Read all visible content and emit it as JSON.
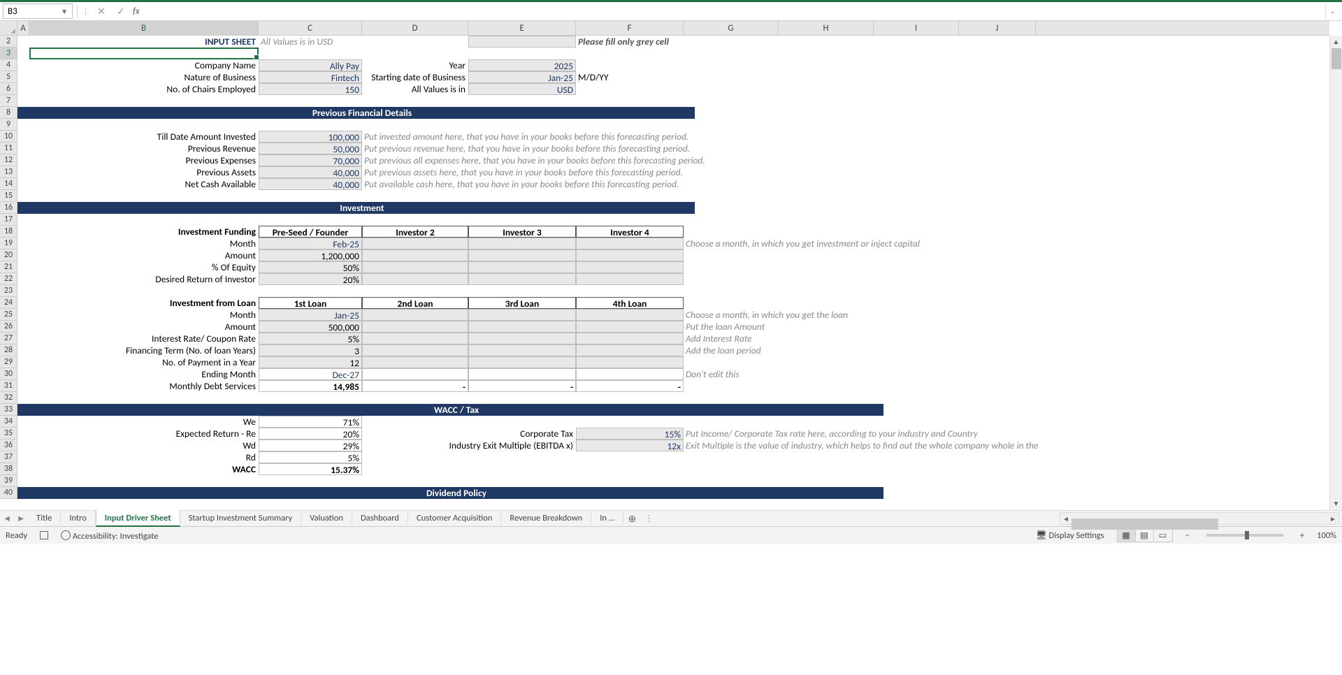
{
  "nameBox": "B3",
  "formula": "",
  "columns": [
    "A",
    "B",
    "C",
    "D",
    "E",
    "F",
    "G",
    "H",
    "I",
    "J"
  ],
  "rows": [
    "2",
    "3",
    "4",
    "5",
    "6",
    "7",
    "8",
    "9",
    "10",
    "11",
    "12",
    "13",
    "14",
    "15",
    "16",
    "17",
    "18",
    "19",
    "20",
    "21",
    "22",
    "23",
    "24",
    "25",
    "26",
    "27",
    "28",
    "29",
    "30",
    "31",
    "32",
    "33",
    "34",
    "35",
    "36",
    "37",
    "38",
    "39",
    "40"
  ],
  "top": {
    "inputSheet": "INPUT SHEET",
    "allValuesUsd": "All Values is in USD",
    "fillGreyCell": "Please fill only grey cell"
  },
  "company": {
    "labels": {
      "name": "Company Name",
      "nature": "Nature of Business",
      "chairs": "No. of Chairs Employed"
    },
    "values": {
      "name": "Ally Pay",
      "nature": "Fintech",
      "chairs": "150"
    },
    "yearLabel": "Year",
    "yearVal": "2025",
    "startDateLabel": "Starting date of Business",
    "startDateVal": "Jan-25",
    "mdy": "M/D/YY",
    "allValsInLabel": "All Values is in",
    "allValsInVal": "USD"
  },
  "sections": {
    "prevFin": "Previous Financial Details",
    "investment": "Investment",
    "wacc": "WACC / Tax",
    "dividend": "Dividend Policy"
  },
  "prevFin": {
    "rows": [
      {
        "label": "Till Date Amount Invested",
        "val": "100,000",
        "note": "Put invested amount here, that you have in your books before this forecasting period."
      },
      {
        "label": "Previous Revenue",
        "val": "50,000",
        "note": "Put previous revenue here, that you have in your books before this forecasting period."
      },
      {
        "label": "Previous Expenses",
        "val": "70,000",
        "note": "Put previous all expenses here, that you have in your books before this forecasting period."
      },
      {
        "label": "Previous Assets",
        "val": "40,000",
        "note": "Put previous assets here, that you have in your books before this forecasting period."
      },
      {
        "label": "Net Cash Available",
        "val": "40,000",
        "note": "Put available cash here, that you have in your books before this forecasting period."
      }
    ]
  },
  "funding": {
    "header": "Investment Funding",
    "cols": [
      "Pre-Seed / Founder",
      "Investor 2",
      "Investor 3",
      "Investor 4"
    ],
    "rows": {
      "month": "Month",
      "amount": "Amount",
      "equity": "% Of Equity",
      "ret": "Desired Return of Investor"
    },
    "vals": {
      "month": "Feb-25",
      "amount": "1,200,000",
      "equity": "50%",
      "ret": "20%"
    },
    "note": "Choose a month, in which you get investment or inject capital"
  },
  "loan": {
    "header": "Investment from Loan",
    "cols": [
      "1st Loan",
      "2nd Loan",
      "3rd Loan",
      "4th Loan"
    ],
    "rows": {
      "month": "Month",
      "amount": "Amount",
      "rate": "Interest Rate/ Coupon Rate",
      "term": "Financing Term (No. of loan Years)",
      "npay": "No. of Payment in a Year",
      "end": "Ending Month",
      "debt": "Monthly Debt Services"
    },
    "vals": {
      "month": "Jan-25",
      "amount": "500,000",
      "rate": "5%",
      "term": "3",
      "npay": "12",
      "end": "Dec-27",
      "debt": "14,985"
    },
    "dash": "-",
    "notes": {
      "month": "Choose a month, in which you get the loan",
      "amount": "Put the loan Amount",
      "rate": "Add Interest Rate",
      "term": "Add the loan period",
      "end": "Don't edit this"
    }
  },
  "wacc": {
    "rows": {
      "we": "We",
      "re": "Expected Return - Re",
      "wd": "Wd",
      "rd": "Rd",
      "wacc": "WACC"
    },
    "vals": {
      "we": "71%",
      "re": "20%",
      "wd": "29%",
      "rd": "5%",
      "wacc": "15.37%"
    },
    "taxLabel": "Corporate Tax",
    "taxVal": "15%",
    "taxNote": "Put Income/ Corporate Tax rate here, according to your industry and Country",
    "exitLabel": "Industry Exit Multiple (EBITDA x)",
    "exitVal": "12x",
    "exitNote": "Exit Multiple is the value of industry, which helps to find out the whole company whole in the"
  },
  "tabs": [
    "Title",
    "Intro",
    "Input Driver Sheet",
    "Startup Investment Summary",
    "Valuation",
    "Dashboard",
    "Customer Acquisition",
    "Revenue Breakdown",
    "In …"
  ],
  "activeTab": "Input Driver Sheet",
  "status": {
    "ready": "Ready",
    "accessibility": "Accessibility: Investigate",
    "display": "Display Settings",
    "zoom": "100%",
    "minus": "−",
    "plus": "+"
  }
}
